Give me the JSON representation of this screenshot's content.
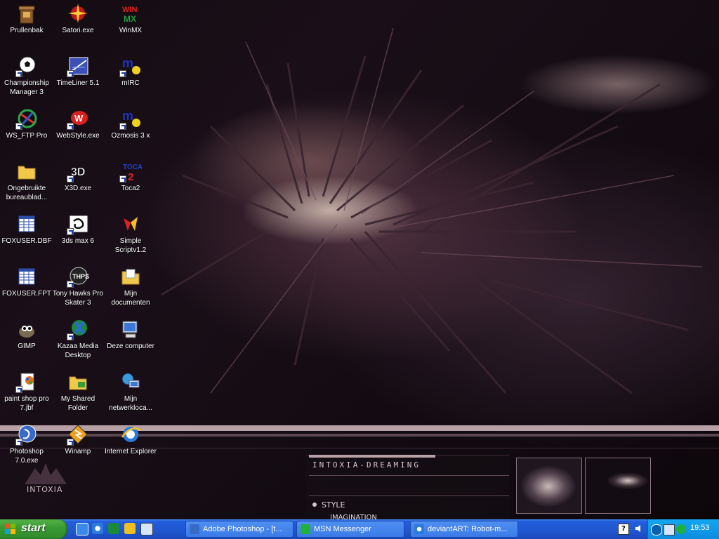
{
  "desktop": {
    "icons": [
      {
        "label": "Prullenbak"
      },
      {
        "label": "Championship Manager 3"
      },
      {
        "label": "WS_FTP Pro"
      },
      {
        "label": "Ongebruikte bureaublad..."
      },
      {
        "label": "FOXUSER.DBF"
      },
      {
        "label": "FOXUSER.FPT"
      },
      {
        "label": "GIMP"
      },
      {
        "label": "paint shop pro 7.jbf"
      },
      {
        "label": "Photoshop 7.0.exe"
      },
      {
        "label": "Satori.exe"
      },
      {
        "label": "TimeLiner 5.1"
      },
      {
        "label": "WebStyle.exe"
      },
      {
        "label": "X3D.exe"
      },
      {
        "label": "3ds max 6"
      },
      {
        "label": "Tony Hawks Pro Skater 3"
      },
      {
        "label": "Kazaa Media Desktop"
      },
      {
        "label": "My Shared Folder"
      },
      {
        "label": "Winamp"
      },
      {
        "label": "WinMX"
      },
      {
        "label": "mIRC"
      },
      {
        "label": "Ozmosis 3 x"
      },
      {
        "label": "Toca2"
      },
      {
        "label": "Simple Scriptv1.2"
      },
      {
        "label": "Mijn documenten"
      },
      {
        "label": "Deze computer"
      },
      {
        "label": "Mijn netwerkloca..."
      },
      {
        "label": "Internet Explorer"
      }
    ],
    "wallpaper": {
      "brand": "INTOXIA",
      "title": "INTOXIA-DREAMING",
      "menu_item_1": "STYLE",
      "menu_item_2": "IMAGINATION"
    }
  },
  "taskbar": {
    "start_label": "start",
    "tasks": [
      {
        "label": "Adobe Photoshop - [t...",
        "icon": "photoshop-icon"
      },
      {
        "label": "MSN Messenger",
        "icon": "msn-icon"
      },
      {
        "label": "deviantART: Robot-m...",
        "icon": "ie-icon"
      }
    ],
    "clock": "19:53"
  },
  "colors": {
    "taskbar_blue": "#245edb",
    "start_green": "#3a9b33",
    "tray_blue": "#0d8de0",
    "wallpaper_band": "#b7a1a6"
  }
}
